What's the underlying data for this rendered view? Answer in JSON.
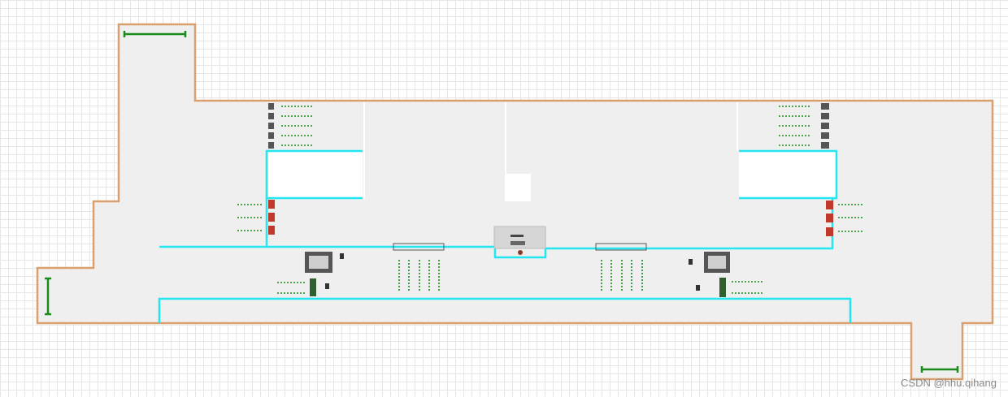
{
  "watermark": "CSDN @hhu.qihang",
  "colors": {
    "wall": "#d9a06e",
    "floor": "#efefef",
    "cyan_line": "#22e6f0",
    "flow": "#1a8a1a",
    "service": "#c0392b",
    "grid": "#e6e6e6"
  },
  "icons": {
    "entry": "entry-bar-icon",
    "queue": "queue-arrow-icon",
    "service": "service-point-icon",
    "machine": "machine-icon",
    "person": "person-icon"
  }
}
